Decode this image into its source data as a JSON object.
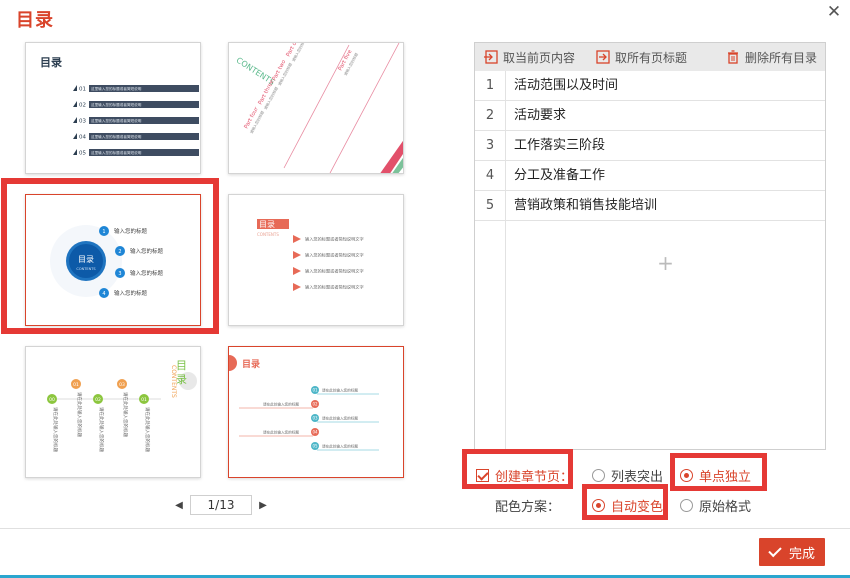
{
  "window": {
    "title": "目录",
    "close_icon": "close-icon"
  },
  "thumbnails": [
    {
      "name": "template-1",
      "heading": "目录",
      "items": [
        "01",
        "02",
        "03",
        "04",
        "05"
      ],
      "item_text": "这里输入您的标题或者简短说明"
    },
    {
      "name": "template-2",
      "logo_text": "CONTENTS",
      "parts": [
        "Part one",
        "Part two",
        "Part three",
        "Part four",
        "Part five"
      ],
      "part_text": "请输入您的标题"
    },
    {
      "name": "template-3",
      "center_title": "目录",
      "center_sub": "CONTENTS",
      "items": [
        "1",
        "2",
        "3",
        "4"
      ],
      "item_text": "输入您的标题",
      "selected": true
    },
    {
      "name": "template-4",
      "heading": "目录",
      "sub": "CONTENTS",
      "item_text": "输入您的标题或者简短说明文字"
    },
    {
      "name": "template-5",
      "heading": "目录",
      "sub": "CONTENTS",
      "nums": [
        "00",
        "01",
        "02",
        "03"
      ],
      "col_text": "请在此处输入您的标题"
    },
    {
      "name": "template-6",
      "heading": "目录",
      "nums": [
        "01",
        "02",
        "03",
        "04",
        "05"
      ],
      "item_text": "请在此处输入您的标题"
    }
  ],
  "pager": {
    "current": "1/13",
    "prev_icon": "caret-left-icon",
    "next_icon": "caret-right-icon"
  },
  "toolbar": {
    "cancel_current": "取当前页内容",
    "cancel_all": "取所有页标题",
    "delete_all": "删除所有目录"
  },
  "toc_items": [
    {
      "index": "1",
      "text": "活动范围以及时间"
    },
    {
      "index": "2",
      "text": "活动要求"
    },
    {
      "index": "3",
      "text": "工作落实三阶段"
    },
    {
      "index": "4",
      "text": "分工及准备工作"
    },
    {
      "index": "5",
      "text": "营销政策和销售技能培训"
    }
  ],
  "add_row_icon": "plus-icon",
  "options": {
    "create_section_label": "创建章节页：",
    "list_highlight_label": "列表突出",
    "single_independent_label": "单点独立",
    "color_scheme_label": "配色方案：",
    "auto_color_label": "自动变色",
    "original_format_label": "原始格式",
    "create_section_checked": true,
    "layout_selected": "单点独立",
    "color_selected": "自动变色"
  },
  "footer": {
    "finish_label": "完成"
  },
  "colors": {
    "accent": "#d9442b",
    "highlight_frame": "#e53935",
    "bottom_bar": "#2aa6cf"
  }
}
